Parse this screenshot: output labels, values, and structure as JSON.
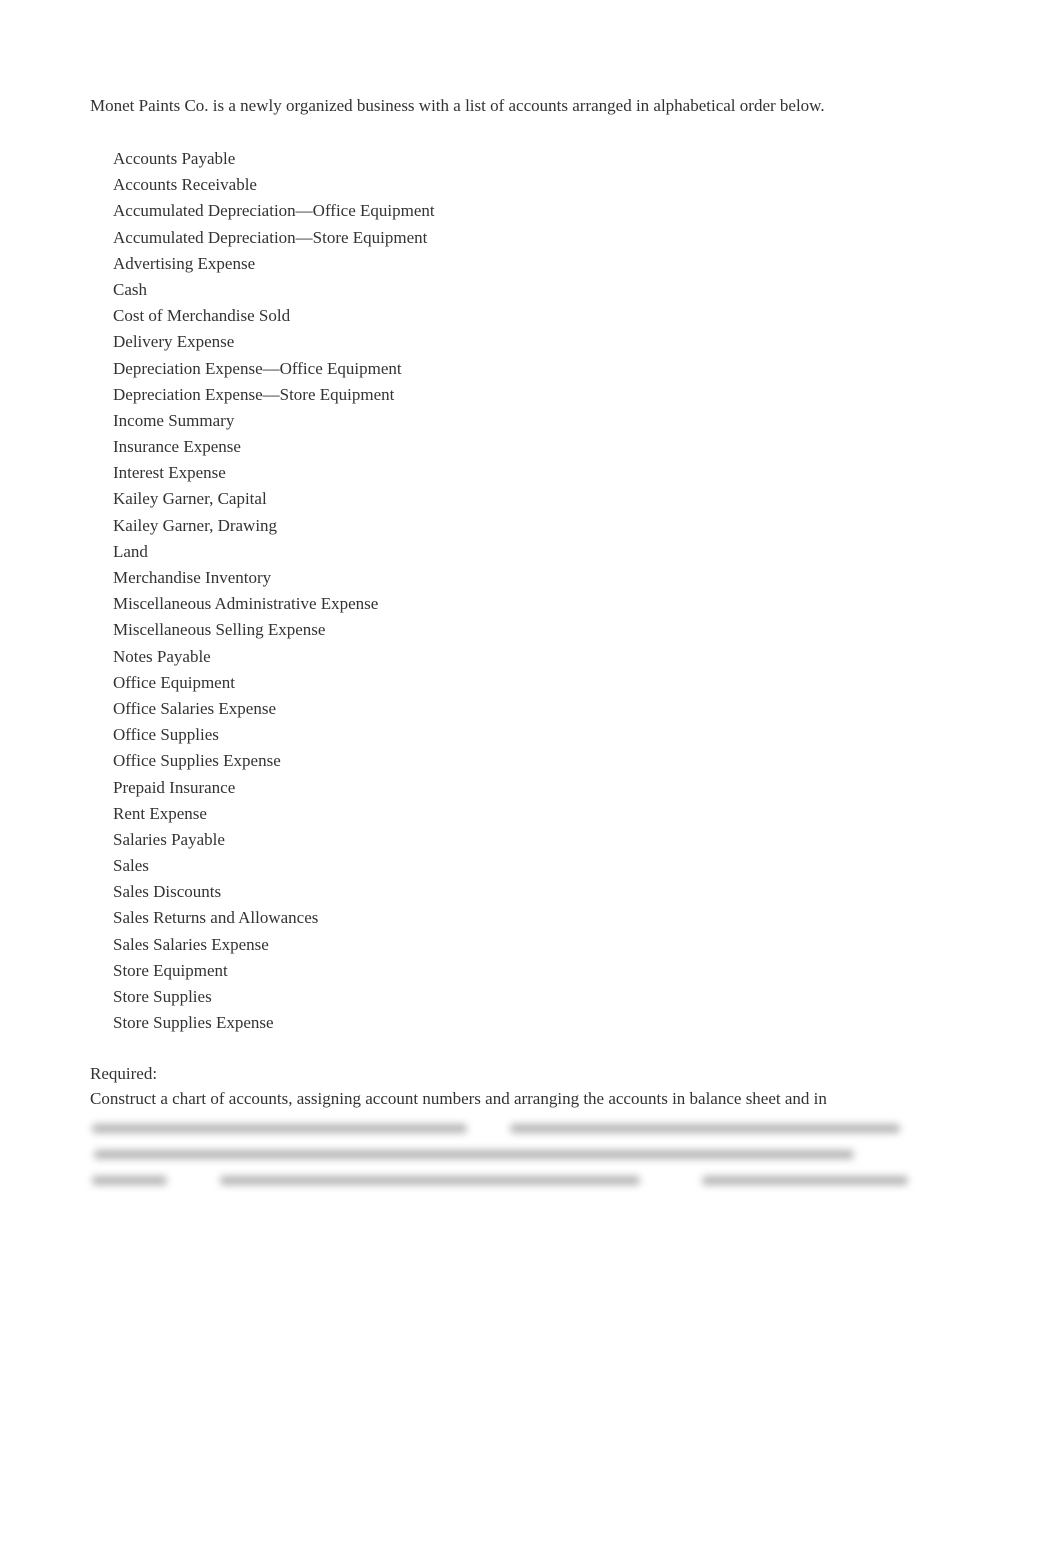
{
  "document": {
    "intro": "Monet Paints Co. is a newly organized business with a list of accounts arranged in alphabetical order below.",
    "accounts": [
      "Accounts Payable",
      "Accounts Receivable",
      "Accumulated Depreciation—Office Equipment",
      "Accumulated Depreciation—Store Equipment",
      "Advertising Expense",
      "Cash",
      "Cost of Merchandise Sold",
      "Delivery Expense",
      "Depreciation Expense—Office Equipment",
      "Depreciation Expense—Store Equipment",
      "Income Summary",
      "Insurance Expense",
      "Interest Expense",
      "Kailey Garner, Capital",
      "Kailey Garner, Drawing",
      "Land",
      "Merchandise Inventory",
      "Miscellaneous Administrative Expense",
      "Miscellaneous Selling Expense",
      "Notes Payable",
      "Office Equipment",
      "Office Salaries Expense",
      "Office Supplies",
      "Office Supplies Expense",
      "Prepaid Insurance",
      "Rent Expense",
      "Salaries Payable",
      "Sales",
      "Sales Discounts",
      "Sales Returns and Allowances",
      "Sales Salaries Expense",
      "Store Equipment",
      "Store Supplies",
      "Store Supplies Expense"
    ],
    "required_label": "Required:",
    "instruction": "Construct a chart of accounts, assigning account numbers and arranging the accounts in balance sheet and in"
  }
}
